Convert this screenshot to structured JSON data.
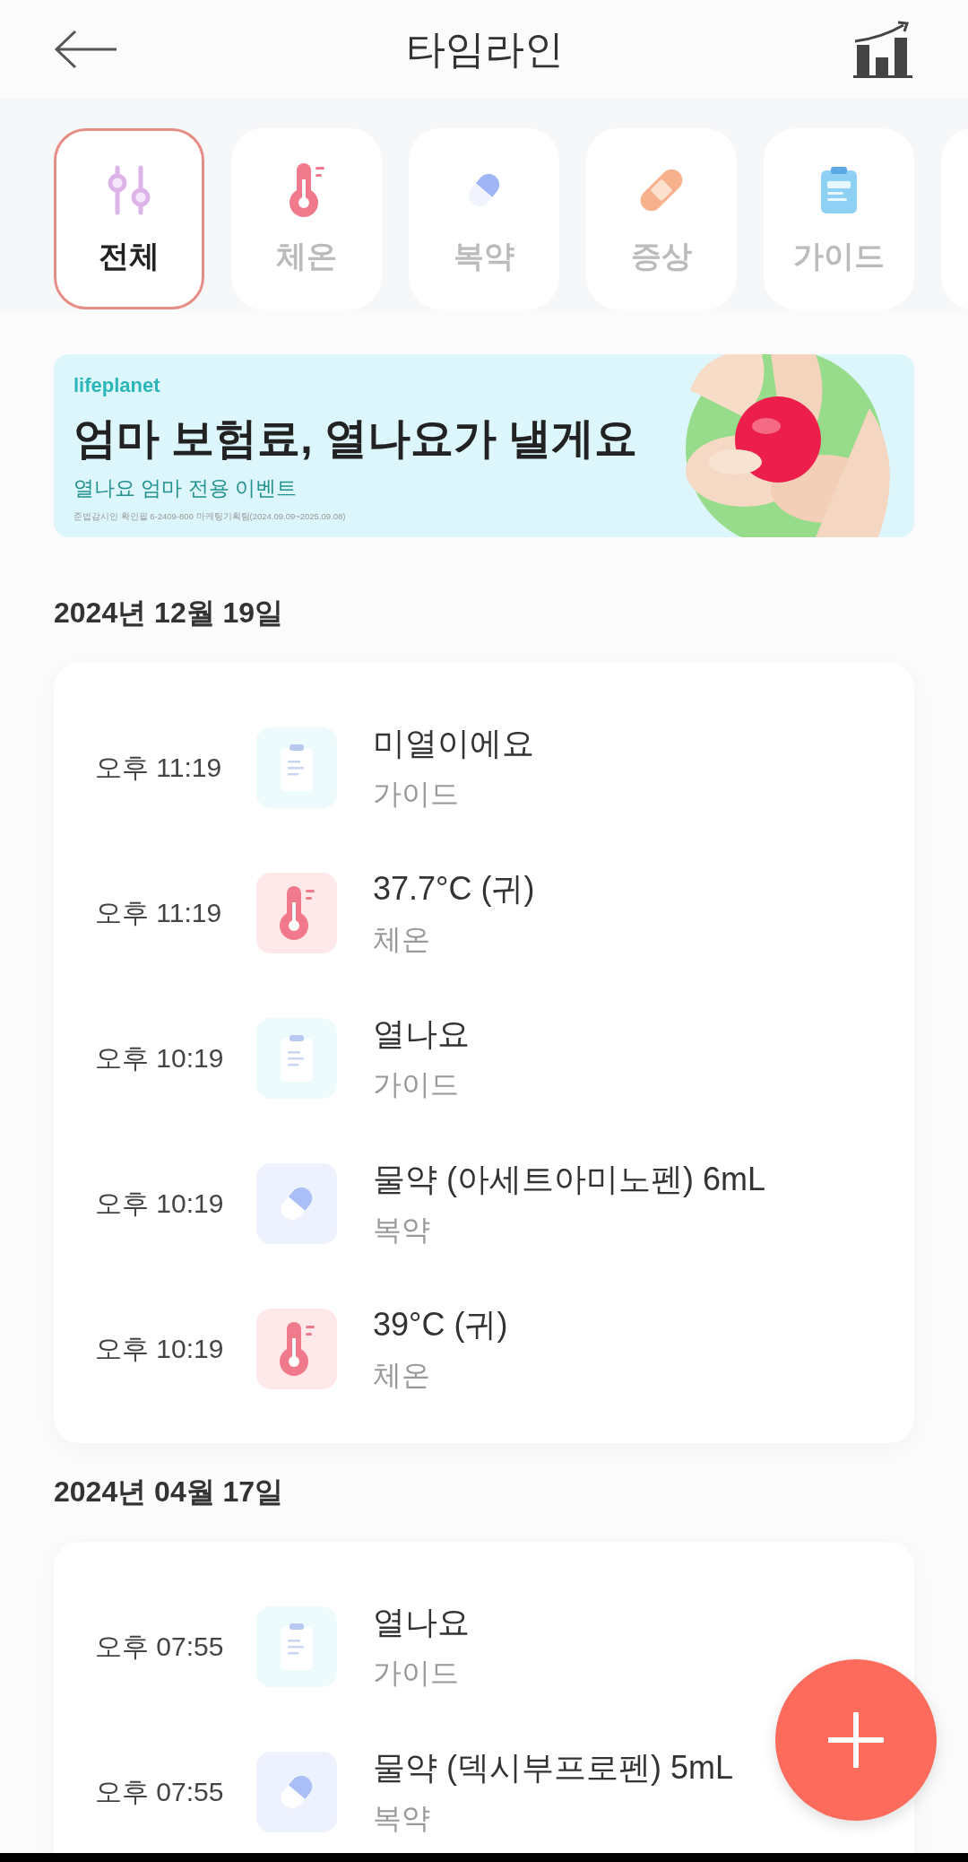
{
  "header": {
    "title": "타임라인"
  },
  "filters": [
    {
      "kind": "all",
      "label": "전체",
      "selected": true
    },
    {
      "kind": "temp",
      "label": "체온",
      "selected": false
    },
    {
      "kind": "med",
      "label": "복약",
      "selected": false
    },
    {
      "kind": "symptom",
      "label": "증상",
      "selected": false
    },
    {
      "kind": "guide",
      "label": "가이드",
      "selected": false
    }
  ],
  "banner": {
    "brand": "lifeplanet",
    "title": "엄마 보험료, 열나요가 낼게요",
    "subtitle": "열나요 엄마 전용 이벤트",
    "disclaimer": "준법감시인 확인필 6-2409-800 마케팅기획팀(2024.09.09~2025.09.08)"
  },
  "days": [
    {
      "date": "2024년 12월 19일",
      "entries": [
        {
          "time": "오후 11:19",
          "kind": "guide",
          "title": "미열이에요",
          "category": "가이드"
        },
        {
          "time": "오후 11:19",
          "kind": "temp",
          "title": "37.7°C (귀)",
          "category": "체온"
        },
        {
          "time": "오후 10:19",
          "kind": "guide",
          "title": "열나요",
          "category": "가이드"
        },
        {
          "time": "오후 10:19",
          "kind": "med",
          "title": "물약 (아세트아미노펜) 6mL",
          "category": "복약"
        },
        {
          "time": "오후 10:19",
          "kind": "temp",
          "title": "39°C (귀)",
          "category": "체온"
        }
      ]
    },
    {
      "date": "2024년 04월 17일",
      "entries": [
        {
          "time": "오후 07:55",
          "kind": "guide",
          "title": "열나요",
          "category": "가이드"
        },
        {
          "time": "오후 07:55",
          "kind": "med",
          "title": "물약 (덱시부프로펜) 5mL",
          "category": "복약"
        }
      ]
    }
  ]
}
